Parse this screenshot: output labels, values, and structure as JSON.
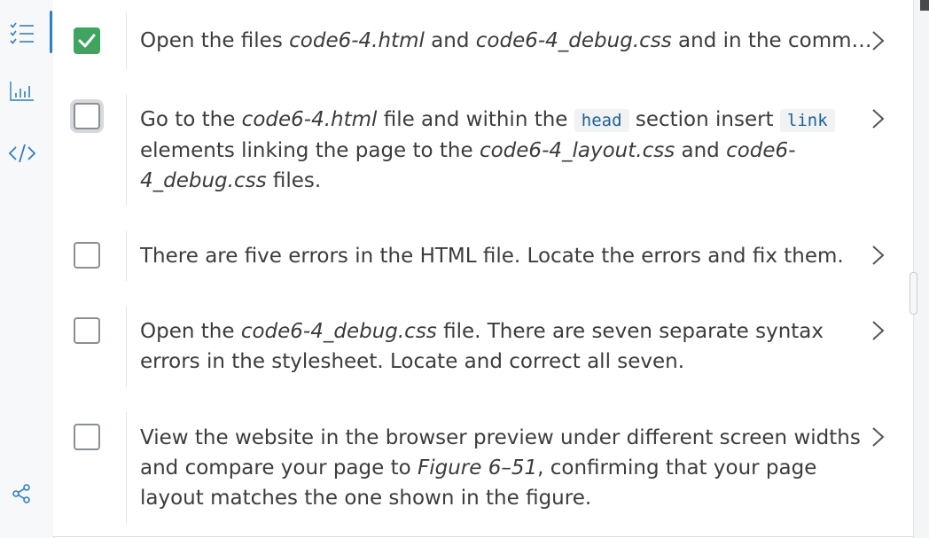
{
  "sidebar": {
    "items": [
      {
        "icon": "checklist-icon",
        "active": true
      },
      {
        "icon": "bar-chart-icon",
        "active": false
      },
      {
        "icon": "code-icon",
        "active": false
      },
      {
        "icon": "share-icon",
        "active": false
      }
    ]
  },
  "tasks": [
    {
      "checked": true,
      "parts": [
        "Open the files ",
        "code6-4.html",
        " and ",
        "code6-4_debug.css",
        " and in the comm…"
      ]
    },
    {
      "checked": false,
      "parts": [
        "Go to the ",
        "code6-4.html",
        " file and within the ",
        "head",
        " section insert ",
        "link",
        "elements linking the page to the ",
        "code6-4_layout.css",
        " and ",
        "code6-",
        "4_debug.css",
        " files."
      ]
    },
    {
      "checked": false,
      "parts": [
        "There are five errors in the HTML file. Locate the errors and fix them."
      ]
    },
    {
      "checked": false,
      "parts": [
        "Open the ",
        "code6-4_debug.css",
        " file. There are seven separate syntax",
        "errors in the stylesheet. Locate and correct all seven."
      ]
    },
    {
      "checked": false,
      "parts": [
        "View the website in the browser preview under different screen widths",
        "and compare your page to ",
        "Figure 6–51",
        ", confirming that your page",
        "layout matches the one shown in the figure."
      ]
    }
  ],
  "colors": {
    "checked": "#3ea45f",
    "accent": "#2f7fc1",
    "code_text": "#1f5f95"
  }
}
